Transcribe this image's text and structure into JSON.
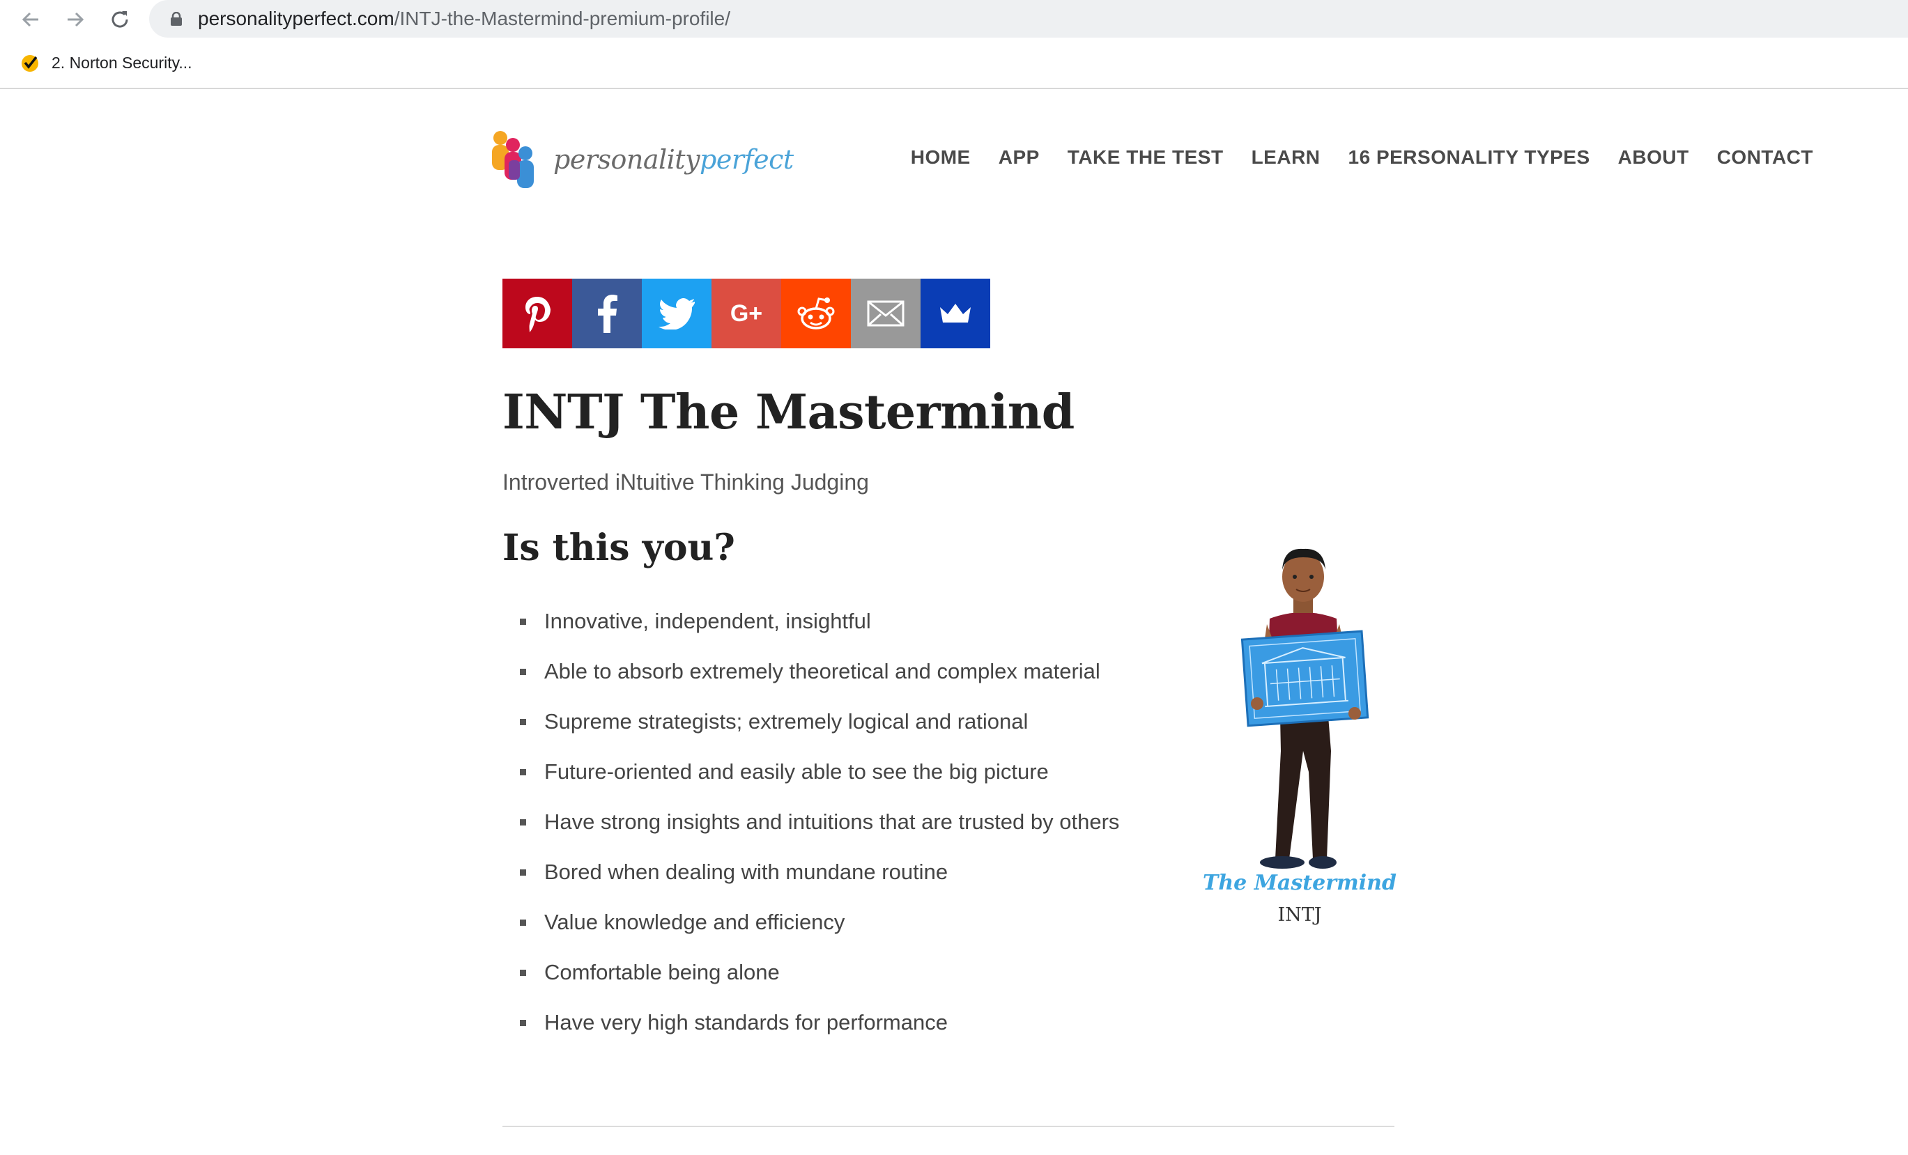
{
  "browser": {
    "url_host": "personalityperfect.com",
    "url_path": "/INTJ-the-Mastermind-premium-profile/",
    "bookmark_label": "2. Norton Security..."
  },
  "site": {
    "logo_part1": "personality",
    "logo_part2": "perfect",
    "nav": [
      "HOME",
      "APP",
      "TAKE THE TEST",
      "LEARN",
      "16 PERSONALITY TYPES",
      "ABOUT",
      "CONTACT"
    ]
  },
  "share": {
    "icons": [
      "pinterest-icon",
      "facebook-icon",
      "twitter-icon",
      "google-plus-icon",
      "reddit-icon",
      "email-icon",
      "crown-icon"
    ],
    "colors": [
      "#bd081c",
      "#3b5998",
      "#1da1f2",
      "#dc4e41",
      "#ff4500",
      "#999999",
      "#0a3db5"
    ],
    "gplus_label": "G+"
  },
  "profile": {
    "title": "INTJ The Mastermind",
    "subtitle": "Introverted iNtuitive Thinking Judging",
    "section_heading": "Is this you?",
    "traits": [
      "Innovative, independent, insightful",
      "Able to absorb extremely theoretical and complex material",
      "Supreme strategists; extremely logical and rational",
      "Future-oriented and easily able to see the big picture",
      "Have strong insights and intuitions that are trusted by others",
      "Bored when dealing with mundane routine",
      "Value knowledge and efficiency",
      "Comfortable being alone",
      "Have very high standards for performance"
    ],
    "caption_name": "The Mastermind",
    "caption_type": "INTJ"
  }
}
